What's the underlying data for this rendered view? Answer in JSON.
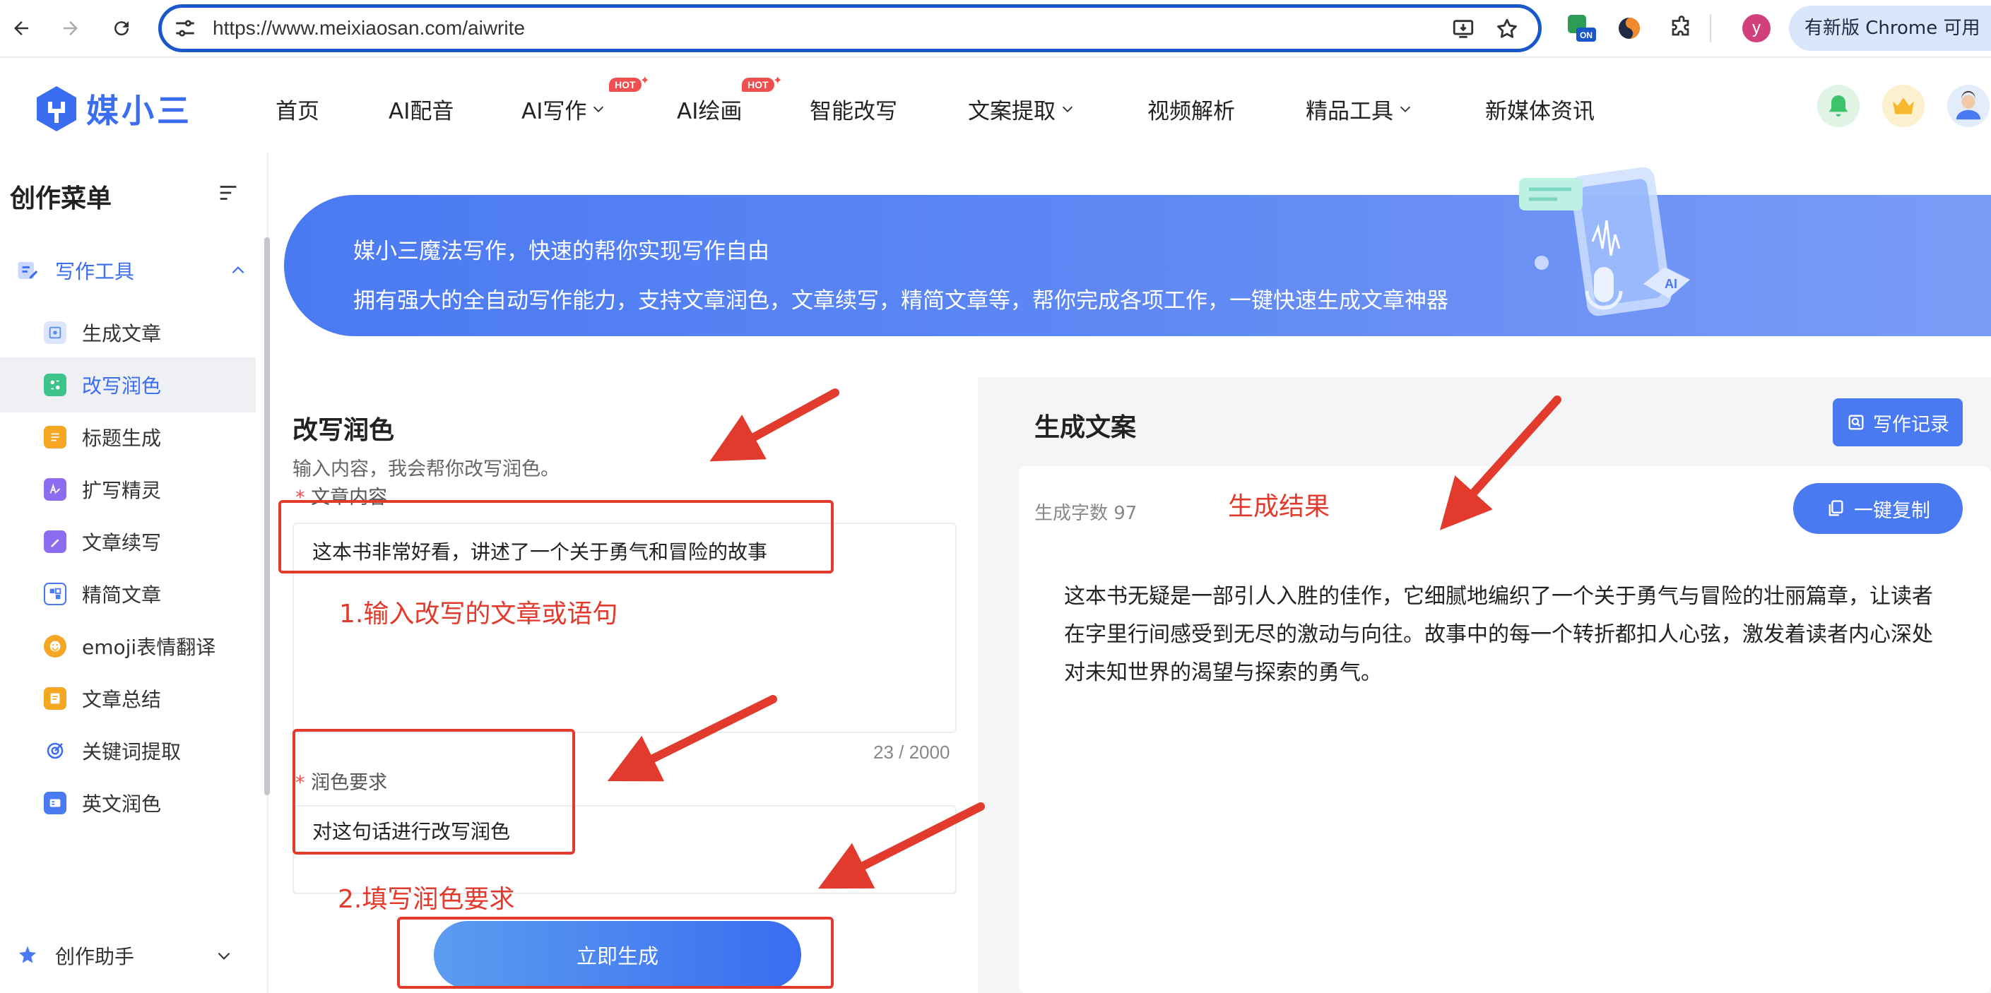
{
  "browser": {
    "url": "https://www.meixiaosan.com/aiwrite",
    "update_label": "有新版 Chrome 可用",
    "profile_initial": "y",
    "extension_badge": "ON"
  },
  "site": {
    "logo_text": "媒小三",
    "nav": [
      {
        "label": "首页"
      },
      {
        "label": "AI配音"
      },
      {
        "label": "AI写作",
        "badge": "HOT"
      },
      {
        "label": "AI绘画",
        "badge": "HOT"
      },
      {
        "label": "智能改写"
      },
      {
        "label": "文案提取"
      },
      {
        "label": "视频解析"
      },
      {
        "label": "精品工具"
      },
      {
        "label": "新媒体资讯"
      }
    ]
  },
  "sidebar": {
    "title": "创作菜单",
    "group1": "写作工具",
    "items": [
      {
        "label": "生成文章",
        "color": "#5b8def"
      },
      {
        "label": "改写润色",
        "color": "#3cc48a"
      },
      {
        "label": "标题生成",
        "color": "#f5a623"
      },
      {
        "label": "扩写精灵",
        "color": "#8c6cf0"
      },
      {
        "label": "文章续写",
        "color": "#8c6cf0"
      },
      {
        "label": "精简文章",
        "color": "#4a7af2"
      },
      {
        "label": "emoji表情翻译",
        "color": "#f5a623"
      },
      {
        "label": "文章总结",
        "color": "#f5a623"
      },
      {
        "label": "关键词提取",
        "color": "#3a6df0"
      },
      {
        "label": "英文润色",
        "color": "#4a7af2"
      }
    ],
    "group2": "创作助手"
  },
  "banner": {
    "line1": "媒小三魔法写作，快速的帮你实现写作自由",
    "line2": "拥有强大的全自动写作能力，支持文章润色，文章续写，精简文章等，帮你完成各项工作，一键快速生成文章神器"
  },
  "form": {
    "title": "改写润色",
    "subtitle": "输入内容，我会帮你改写润色。",
    "content_label": "文章内容",
    "content_value": "这本书非常好看，讲述了一个关于勇气和冒险的故事",
    "counter": "23 / 2000",
    "requirement_label": "润色要求",
    "requirement_value": "对这句话进行改写润色",
    "submit": "立即生成"
  },
  "result": {
    "title": "生成文案",
    "record_button": "写作记录",
    "word_count": "生成字数 97",
    "copy_button": "一键复制",
    "text": "这本书无疑是一部引人入胜的佳作，它细腻地编织了一个关于勇气与冒险的壮丽篇章，让读者在字里行间感受到无尽的激动与向往。故事中的每一个转折都扣人心弦，激发着读者内心深处对未知世界的渴望与探索的勇气。"
  },
  "annotations": {
    "step1": "1.输入改写的文章或语句",
    "step2": "2.填写润色要求",
    "result_label": "生成结果",
    "color": "#e23a2c"
  },
  "colors": {
    "accent": "#3a6df0",
    "annotation": "#e23a2c"
  }
}
